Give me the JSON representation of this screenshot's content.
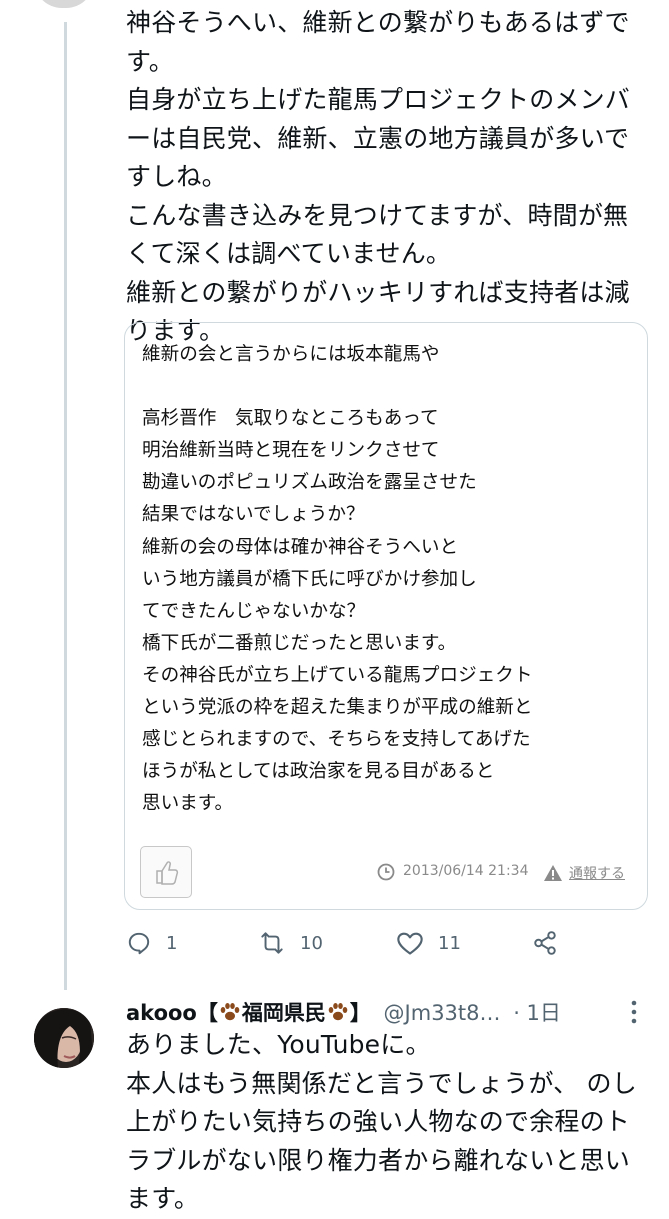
{
  "tweet": {
    "lines": [
      "神谷そうへい、維新との繋がりもあるはずで",
      "す。",
      "自身が立ち上げた龍馬プロジェクトのメンバ",
      "ーは自民党、維新、立憲の地方議員が多いで",
      "すしね。",
      "こんな書き込みを見つけてますが、時間が無",
      "くて深くは調べていません。",
      "維新との繋がりがハッキリすれば支持者は減",
      "ります。"
    ],
    "quote": {
      "lines": [
        "維新の会と言うからには坂本龍馬や",
        "",
        "高杉晋作　気取りなところもあって",
        "明治維新当時と現在をリンクさせて",
        "勘違いのポピュリズム政治を露呈させた",
        "結果ではないでしょうか？",
        "維新の会の母体は確か神谷そうへいと",
        "いう地方議員が橋下氏に呼びかけ参加し",
        "てできたんじゃないかな？",
        "橋下氏が二番煎じだったと思います。",
        "その神谷氏が立ち上げている龍馬プロジェクト",
        "という党派の枠を超えた集まりが平成の維新と",
        "感じとられますので、そちらを支持してあげた",
        "ほうが私としては政治家を見る目があると",
        "思います。"
      ],
      "timestamp": "2013/06/14 21:34",
      "report_label": "通報する"
    },
    "actions": {
      "reply_count": "1",
      "retweet_count": "10",
      "like_count": "11"
    }
  },
  "reply": {
    "name_prefix": "akooo【",
    "name_place": "福岡県民",
    "name_suffix": "】",
    "handle": "@Jm33t8…",
    "time": "· 1日",
    "lines": [
      "ありました、YouTubeに。",
      "本人はもう無関係だと言うでしょうが、 のし",
      "上がりたい気持ちの強い人物なので余程のト",
      "ラブルがない限り権力者から離れないと思い",
      "ます。"
    ]
  },
  "colors": {
    "thread_line": "#cfd9de",
    "icon_gray": "#536471",
    "paw_brown": "#8b4a1c"
  }
}
